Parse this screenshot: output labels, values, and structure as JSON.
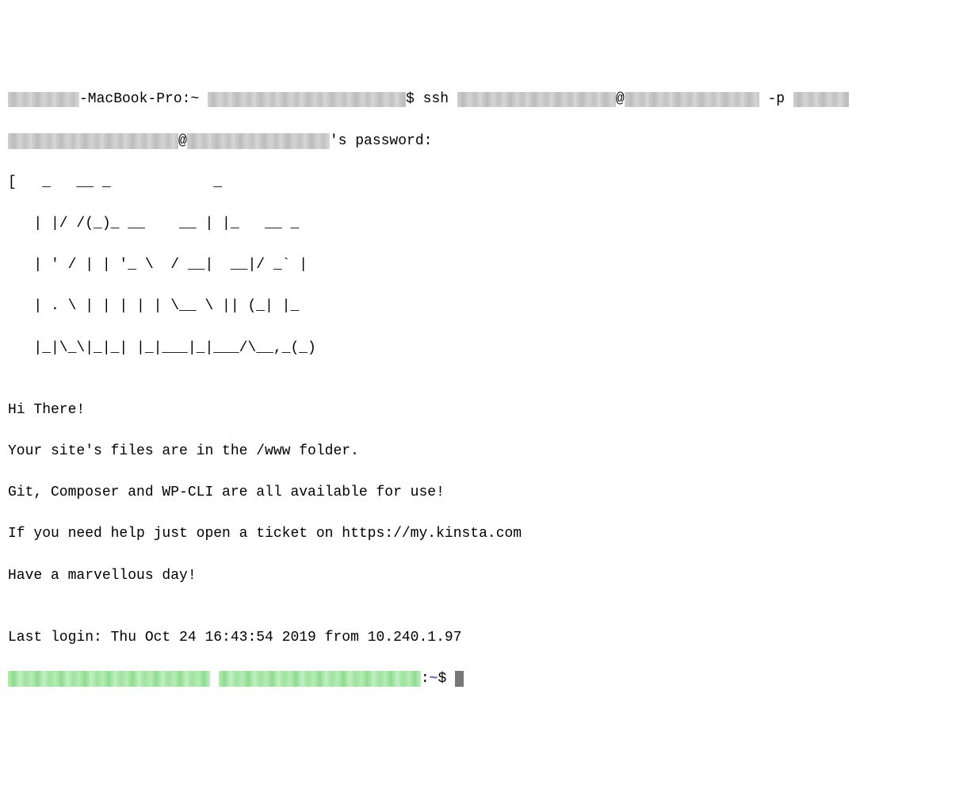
{
  "line1": {
    "hostPrefix": "-MacBook-Pro:~ ",
    "dollarSsh": "$ ssh ",
    "at": "@",
    "dashP": " -p "
  },
  "line2": {
    "at": "@",
    "pwPrompt": "'s password:"
  },
  "ascii": [
    "[   _   __ _            _            ",
    "   | |/ /(_)_ __    __ | |_   __ _   ",
    "   | ' / | | '_ \\  / __|  __|/ _` |  ",
    "   | . \\ | | | | | \\__ \\ || (_| |_ ",
    "   |_|\\_\\|_|_| |_|___|_|___/\\__,_(_)"
  ],
  "welcome": [
    "",
    "Hi There!",
    "Your site's files are in the /www folder.",
    "Git, Composer and WP-CLI are all available for use!",
    "If you need help just open a ticket on https://my.kinsta.com",
    "Have a marvellous day!",
    ""
  ],
  "lastLogin": "Last login: Thu Oct 24 16:43:54 2019 from 10.240.1.97",
  "promptTail": {
    "colon": ":",
    "tilde": "~",
    "dollar": "$ "
  }
}
